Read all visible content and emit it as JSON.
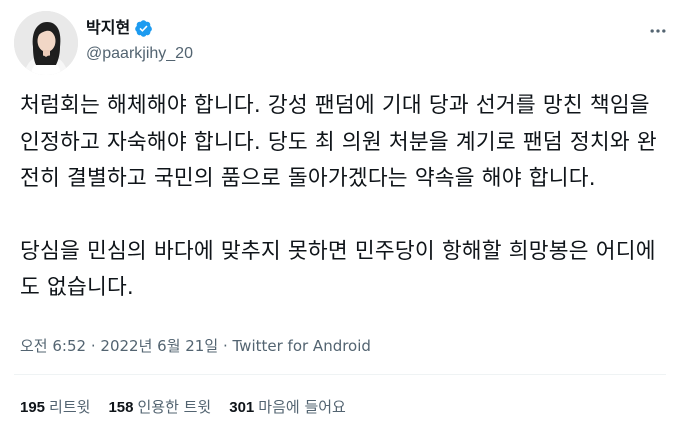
{
  "colors": {
    "text_primary": "#0f1419",
    "text_secondary": "#536471",
    "verified_badge": "#1d9bf0",
    "divider": "#eff3f4"
  },
  "author": {
    "display_name": "박지현",
    "handle": "@paarkjihy_20",
    "verified": true,
    "avatar_icon": "profile-photo"
  },
  "tweet": {
    "paragraph_1": "처럼회는 해체해야 합니다. 강성 팬덤에 기대 당과 선거를 망친 책임을 인정하고 자숙해야 합니다. 당도 최 의원 처분을 계기로 팬덤 정치와 완전히 결별하고 국민의 품으로 돌아가겠다는 약속을 해야 합니다.",
    "paragraph_2": "당심을 민심의 바다에 맞추지 못하면 민주당이 항해할 희망봉은 어디에도 없습니다."
  },
  "meta": {
    "time": "오전 6:52",
    "separator": "·",
    "date": "2022년 6월 21일",
    "source": "Twitter for Android"
  },
  "stats": {
    "retweets_count": "195",
    "retweets_label": "리트윗",
    "quotes_count": "158",
    "quotes_label": "인용한 트윗",
    "likes_count": "301",
    "likes_label": "마음에 들어요"
  }
}
